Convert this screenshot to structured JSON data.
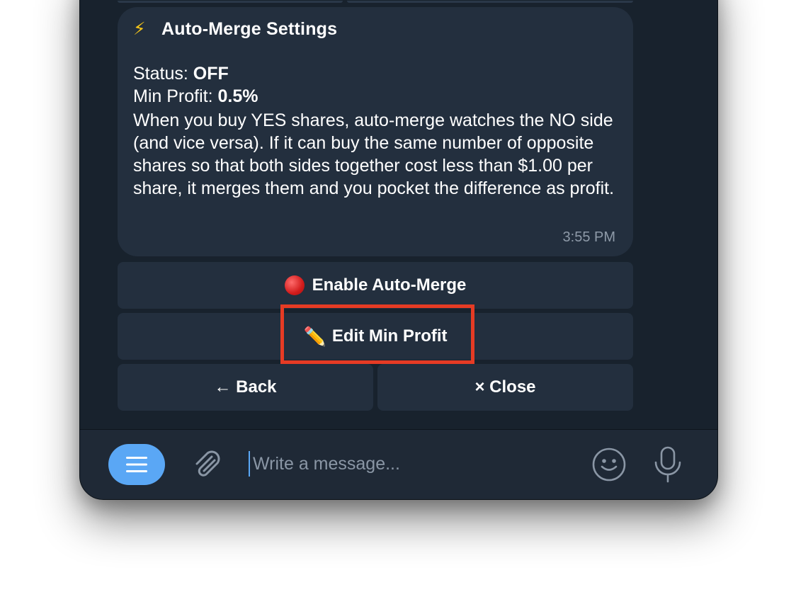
{
  "message": {
    "title": "Auto-Merge Settings",
    "title_icon": "lightning-bolt-icon",
    "status_label": "Status:",
    "status_value": "OFF",
    "min_profit_label": "Min Profit:",
    "min_profit_value": "0.5%",
    "description": "When you buy YES shares, auto-merge watches the NO side (and vice versa). If it can buy the same number of opposite shares so that both sides together cost less than $1.00 per share, it merges them and you pocket the difference as profit.",
    "time": "3:55 PM"
  },
  "keyboard": {
    "enable_label": "Enable Auto-Merge",
    "edit_label": "Edit Min Profit",
    "back_label": "← Back",
    "close_label": "× Close"
  },
  "composer": {
    "placeholder": "Write a message..."
  },
  "colors": {
    "background": "#18222d",
    "bubble": "#232f3e",
    "accent": "#5aa7f5",
    "highlight": "#e63b24"
  }
}
